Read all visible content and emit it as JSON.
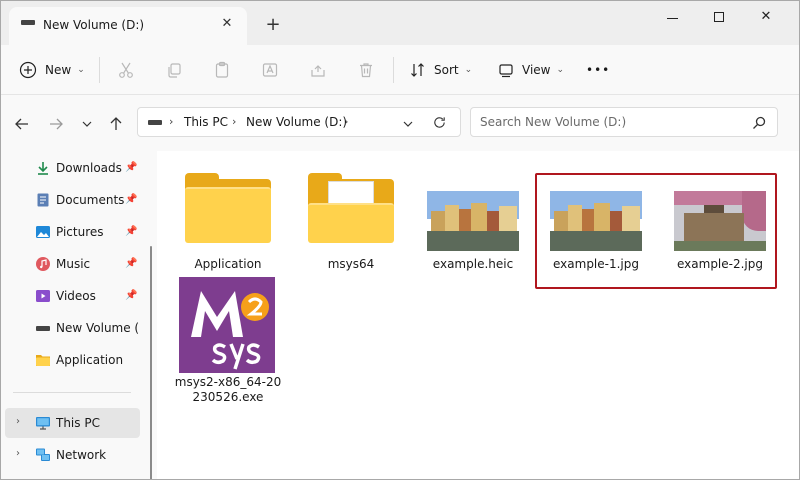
{
  "window": {
    "tab_title": "New Volume (D:)",
    "close_tab": "✕",
    "new_tab": "+",
    "close": "✕"
  },
  "toolbar": {
    "new_label": "New",
    "sort_label": "Sort",
    "view_label": "View",
    "more": "•••"
  },
  "address": {
    "crumbs": [
      "This PC",
      "New Volume (D:)"
    ],
    "search_placeholder": "Search New Volume (D:)"
  },
  "sidebar": {
    "quick_access": [
      {
        "label": "Downloads",
        "icon": "download-icon",
        "pinned": true
      },
      {
        "label": "Documents",
        "icon": "document-icon",
        "pinned": true
      },
      {
        "label": "Pictures",
        "icon": "pictures-icon",
        "pinned": true
      },
      {
        "label": "Music",
        "icon": "music-icon",
        "pinned": true
      },
      {
        "label": "Videos",
        "icon": "videos-icon",
        "pinned": true
      },
      {
        "label": "New Volume (D:)",
        "icon": "drive-icon",
        "pinned": false
      },
      {
        "label": "Application",
        "icon": "folder-icon",
        "pinned": false
      }
    ],
    "tree": [
      {
        "label": "This PC",
        "icon": "monitor-icon",
        "selected": true
      },
      {
        "label": "Network",
        "icon": "network-icon",
        "selected": false
      }
    ]
  },
  "files": [
    {
      "name": "Application",
      "kind": "folder"
    },
    {
      "name": "msys64",
      "kind": "folder-with-docs"
    },
    {
      "name": "example.heic",
      "kind": "photo"
    },
    {
      "name": "example-1.jpg",
      "kind": "photo",
      "highlighted": true
    },
    {
      "name": "example-2.jpg",
      "kind": "photo",
      "highlighted": true
    },
    {
      "name": "msys2-x86_64-20\n230526.exe",
      "kind": "installer",
      "logo_text": "M2 sys"
    }
  ],
  "colors": {
    "accent_highlight": "#b0161e",
    "folder_yellow": "#ffd24c",
    "msys_purple": "#7e3d8f"
  }
}
